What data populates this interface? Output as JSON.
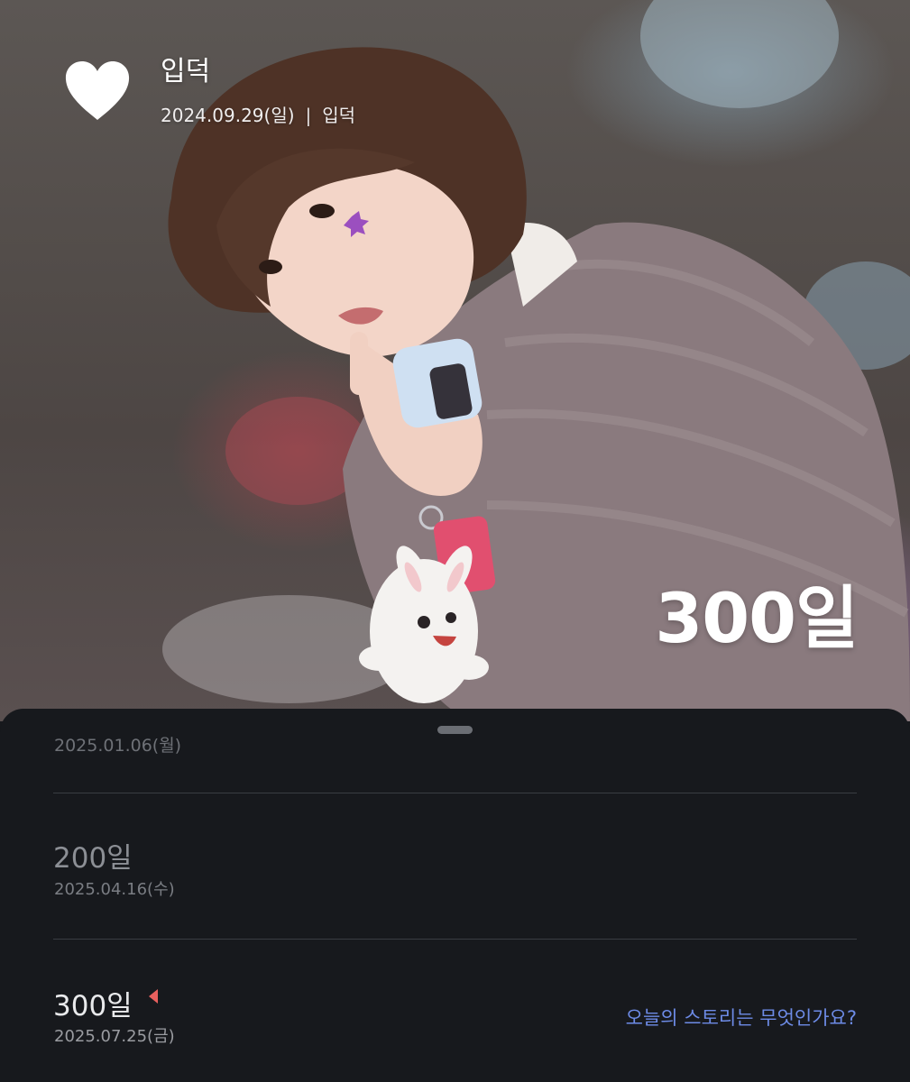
{
  "header": {
    "title": "입덕",
    "date": "2024.09.29(일)",
    "separator": "|",
    "category": "입덕",
    "icon": "heart-icon"
  },
  "hero": {
    "days_label": "300일",
    "photo": "person-photo"
  },
  "sheet": {
    "handle_icon": "drag-handle",
    "partial_date": "2025.01.06(월)",
    "milestones": [
      {
        "title": "200일",
        "date": "2025.04.16(수)"
      },
      {
        "title": "300일",
        "date": "2025.07.25(금)",
        "marker_icon": "current-marker-icon",
        "marker_color": "#e8605e"
      }
    ],
    "story_link": "오늘의 스토리는 무엇인가요?"
  },
  "colors": {
    "sheet_background": "#17191d",
    "link": "#6d8be6",
    "divider": "#3a3d43"
  }
}
